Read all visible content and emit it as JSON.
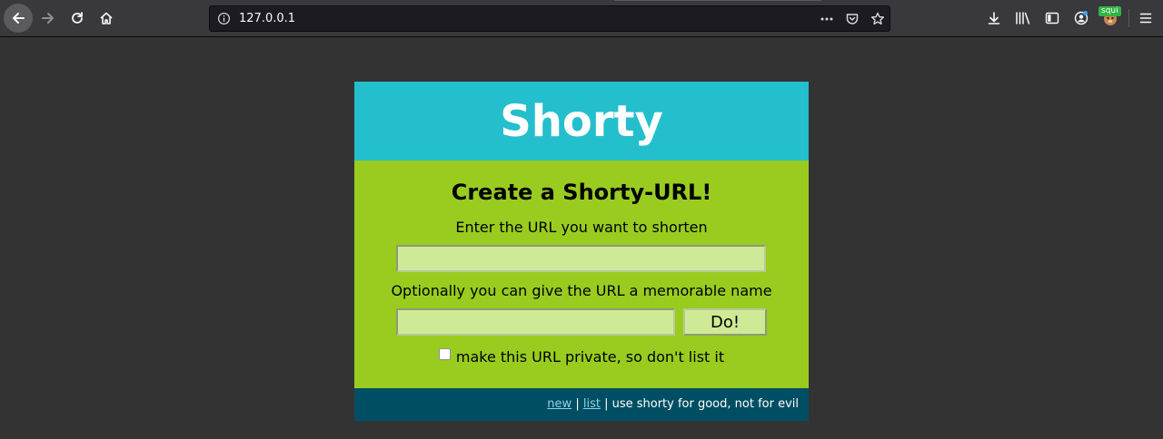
{
  "browser": {
    "url": "127.0.0.1",
    "extension_badge": "squi",
    "icons": {
      "back": "arrow-left-icon",
      "forward": "arrow-right-icon",
      "reload": "reload-icon",
      "home": "home-icon",
      "site_info": "info-icon",
      "page_actions": "more-horizontal-icon",
      "pocket": "pocket-icon",
      "bookmark": "star-icon",
      "downloads": "download-icon",
      "library": "library-icon",
      "sidebar": "sidebar-icon",
      "account": "account-icon",
      "extension": "extension-icon",
      "menu": "hamburger-menu-icon"
    }
  },
  "app": {
    "title": "Shorty",
    "form": {
      "heading": "Create a Shorty-URL!",
      "url_label": "Enter the URL you want to shorten",
      "url_value": "",
      "name_label": "Optionally you can give the URL a memorable name",
      "name_value": "",
      "submit_label": "Do!",
      "private_checked": false,
      "private_label": "make this URL private, so don't list it"
    },
    "footer": {
      "new_link": "new",
      "separator": "|",
      "list_link": "list",
      "tagline": "| use shorty for good, not for evil"
    }
  },
  "colors": {
    "header_bg": "#24bfcc",
    "body_bg": "#99cc1f",
    "footer_bg": "#004e63",
    "input_bg": "#cfea97",
    "page_bg": "#333333"
  }
}
